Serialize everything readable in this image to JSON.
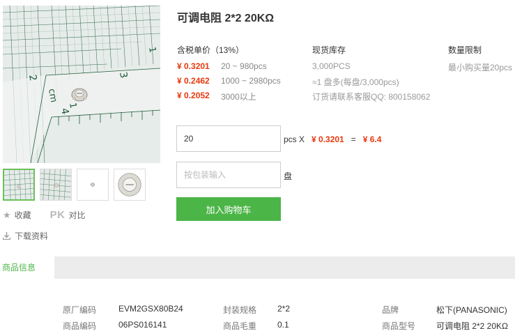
{
  "product": {
    "title": "可调电阻 2*2 20KΩ"
  },
  "gallery": {
    "thumbnails": [
      "thumb-1",
      "thumb-2",
      "thumb-3",
      "thumb-4"
    ],
    "ruler_numbers": [
      "2",
      "3",
      "4",
      "cm",
      "1",
      "1"
    ]
  },
  "actions": {
    "favorite_label": "收藏",
    "pk_label": "PK",
    "compare_label": "对比",
    "download_label": "下载资料"
  },
  "pricing": {
    "header": "含税单价（13%）",
    "tiers": [
      {
        "price": "¥ 0.3201",
        "range": "20 ~ 980pcs"
      },
      {
        "price": "¥ 0.2462",
        "range": "1000 ~ 2980pcs"
      },
      {
        "price": "¥ 0.2052",
        "range": "3000以上"
      }
    ]
  },
  "stock": {
    "header": "现货库存",
    "lines": [
      "3,000PCS",
      "≈1 盘多(每盘/3,000pcs)",
      "订货请联系客服QQ: 800158062"
    ]
  },
  "limit": {
    "header": "数量限制",
    "text": "最小购买量20pcs"
  },
  "order": {
    "quantity": "20",
    "unit_text": "pcs X",
    "unit_price": "¥ 0.3201",
    "equals": "=",
    "total": "¥ 6.4",
    "pack_placeholder": "按包装输入",
    "pack_unit": "盘",
    "cart_button": "加入购物车"
  },
  "info": {
    "tab_label": "商品信息",
    "specs": [
      {
        "label": "原厂编码",
        "value": "EVM2GSX80B24"
      },
      {
        "label": "封装规格",
        "value": "2*2"
      },
      {
        "label": "品牌",
        "value": "松下(PANASONIC)"
      },
      {
        "label": "商品编码",
        "value": "06PS016141"
      },
      {
        "label": "商品毛重",
        "value": "0.1"
      },
      {
        "label": "商品型号",
        "value": "可调电阻 2*2 20KΩ"
      }
    ]
  },
  "colors": {
    "accent_green": "#4cb547",
    "price_red": "#e8380d"
  }
}
